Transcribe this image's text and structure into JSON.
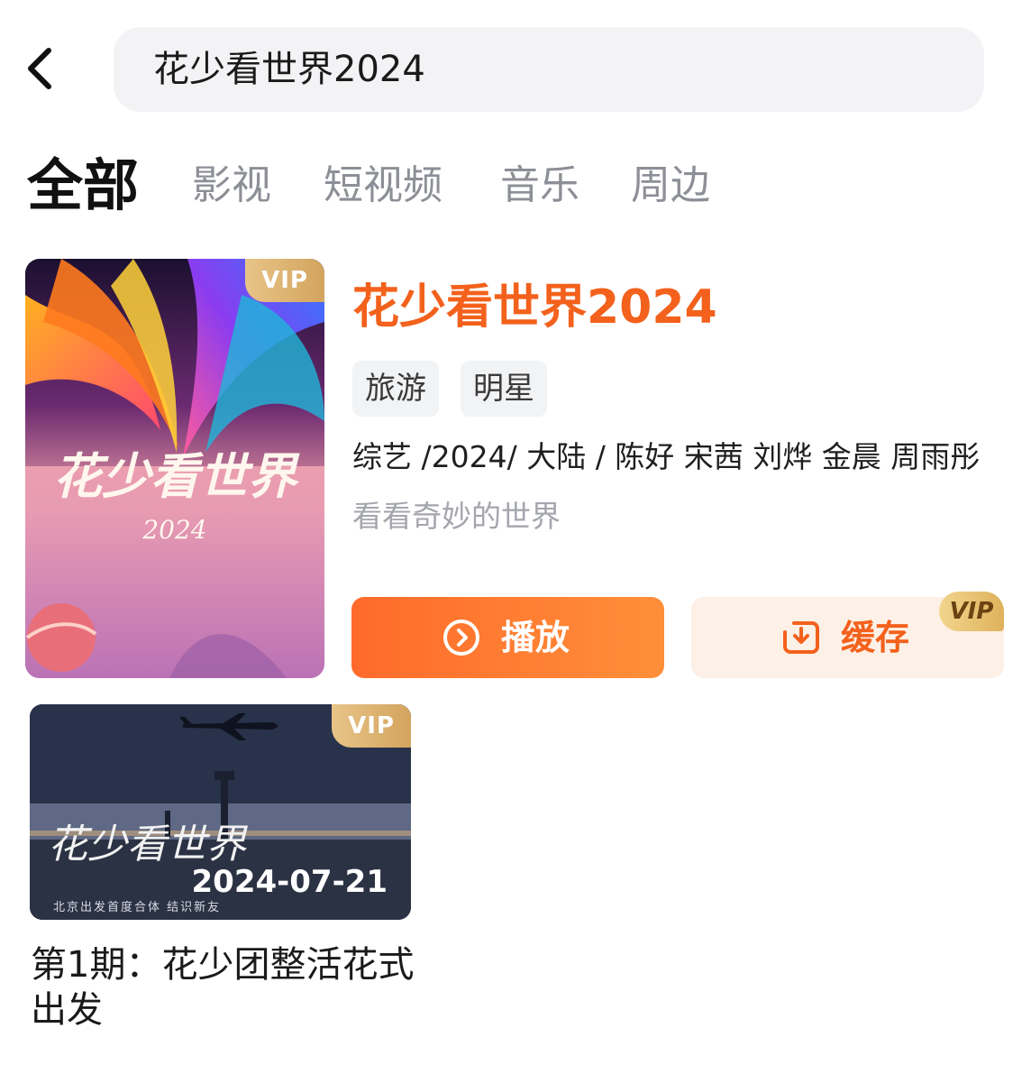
{
  "header": {
    "search_value": "花少看世界2024"
  },
  "tabs": [
    {
      "label": "全部",
      "active": true
    },
    {
      "label": "影视",
      "active": false
    },
    {
      "label": "短视频",
      "active": false
    },
    {
      "label": "音乐",
      "active": false
    },
    {
      "label": "周边",
      "active": false
    }
  ],
  "result": {
    "title": "花少看世界2024",
    "tags": [
      "旅游",
      "明星"
    ],
    "meta": "综艺 /2024/ 大陆 / 陈好 宋茜 刘烨 金晨 周雨彤",
    "description": "看看奇妙的世界",
    "poster": {
      "vip_label": "VIP",
      "title_art": "花少看世界",
      "year_art": "2024"
    },
    "play_label": "播放",
    "cache_label": "缓存",
    "cache_vip_label": "VIP"
  },
  "episode": {
    "vip_label": "VIP",
    "date": "2024-07-21",
    "thumb_art_title": "花少看世界",
    "thumb_subline": "北京出发首度合体 结识新友",
    "title": "第1期：花少团整活花式出发"
  },
  "colors": {
    "accent": "#f3611c",
    "vip_gold": "#d3a45e"
  },
  "icons": {
    "back": "chevron-left-icon",
    "play": "play-circle-icon",
    "cache": "download-icon"
  }
}
